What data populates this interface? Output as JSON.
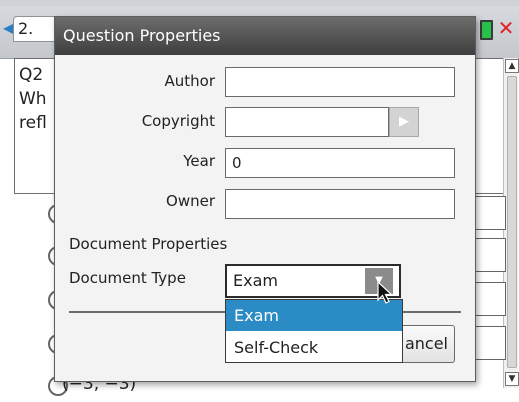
{
  "tabs": [
    "2.",
    "",
    ""
  ],
  "question": {
    "lines": [
      "Q2",
      "Wh",
      "refl"
    ],
    "answer_partial": "(−3, −3)"
  },
  "dialog": {
    "title": "Question Properties",
    "fields": {
      "author_label": "Author",
      "author_value": "",
      "copyright_label": "Copyright",
      "copyright_value": "",
      "year_label": "Year",
      "year_value": "0",
      "owner_label": "Owner",
      "owner_value": ""
    },
    "document_properties_label": "Document Properties",
    "document_type_label": "Document Type",
    "document_type_value": "Exam",
    "dropdown_options": [
      "Exam",
      "Self-Check"
    ],
    "cancel_label": "ancel"
  },
  "icons": {
    "tab_left": "chevron-left-icon",
    "battery": "battery-icon",
    "close": "close-icon",
    "select_arrow": "chevron-down-icon",
    "copyright_arrow": "chevron-right-icon",
    "cursor": "pointer-cursor-icon"
  },
  "colors": {
    "title_bar": "#4a4a4a",
    "dropdown_highlight": "#2b8bc4",
    "close": "#e0212c",
    "battery": "#27c24c"
  }
}
